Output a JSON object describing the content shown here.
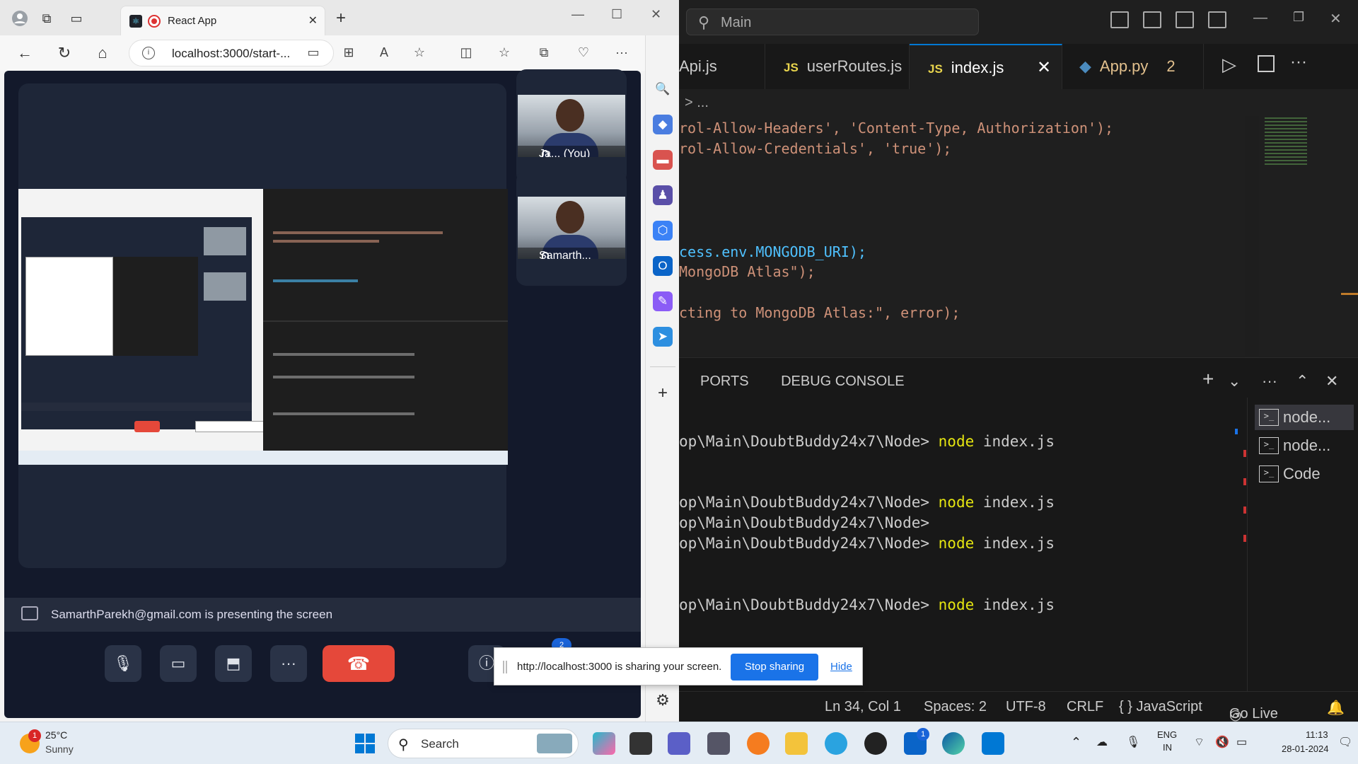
{
  "browser": {
    "tab_title": "React App",
    "url": "localhost:3000/start-...",
    "new_tab": "+"
  },
  "meeting": {
    "participants": [
      {
        "name": "Ja...",
        "suffix": "(You)"
      },
      {
        "name": "Samarth...",
        "suffix": ""
      }
    ],
    "presenting_text": "SamarthParekh@gmail.com is presenting the screen",
    "badge_count": "2"
  },
  "share_popup": {
    "message": "http://localhost:3000 is sharing your screen.",
    "stop_label": "Stop sharing",
    "hide_label": "Hide"
  },
  "vscode": {
    "search": "Main",
    "tabs": [
      {
        "label": "Api.js",
        "icon": "js",
        "active": false
      },
      {
        "label": "userRoutes.js",
        "icon": "js",
        "active": false
      },
      {
        "label": "index.js",
        "icon": "js",
        "active": true
      },
      {
        "label": "App.py",
        "icon": "python",
        "active": false,
        "badge": "2"
      }
    ],
    "breadcrumb": "> ...",
    "code_lines": [
      "rol-Allow-Headers', 'Content-Type, Authorization');",
      "rol-Allow-Credentials', 'true');",
      "cess.env.MONGODB_URI);",
      "MongoDB Atlas\");",
      "cting to MongoDB Atlas:\", error);"
    ],
    "panel_tabs": [
      "PORTS",
      "DEBUG CONSOLE"
    ],
    "terminal_lines": [
      {
        "path": "op\\Main\\DoubtBuddy24x7\\Node> ",
        "cmd": "node",
        "arg": " index.js"
      },
      {
        "path": "op\\Main\\DoubtBuddy24x7\\Node> ",
        "cmd": "node",
        "arg": " index.js"
      },
      {
        "path": "op\\Main\\DoubtBuddy24x7\\Node>",
        "cmd": "",
        "arg": ""
      },
      {
        "path": "op\\Main\\DoubtBuddy24x7\\Node> ",
        "cmd": "node",
        "arg": " index.js"
      },
      {
        "path": "op\\Main\\DoubtBuddy24x7\\Node> ",
        "cmd": "node",
        "arg": " index.js"
      }
    ],
    "terminals": [
      "node...",
      "node...",
      "Code"
    ],
    "status": {
      "position": "Ln 34, Col 1",
      "spaces": "Spaces: 2",
      "encoding": "UTF-8",
      "eol": "CRLF",
      "language": "{ } JavaScript",
      "golive": "Go Live"
    }
  },
  "taskbar": {
    "weather_badge": "1",
    "temperature": "25°C",
    "condition": "Sunny",
    "search": "Search",
    "lang1": "ENG",
    "lang2": "IN",
    "time": "11:13",
    "date": "28-01-2024",
    "mail_badge": "1"
  },
  "colors": {
    "accent_blue": "#1a73e8",
    "end_call_red": "#e5483a",
    "vscode_bg": "#1e1e1e"
  }
}
